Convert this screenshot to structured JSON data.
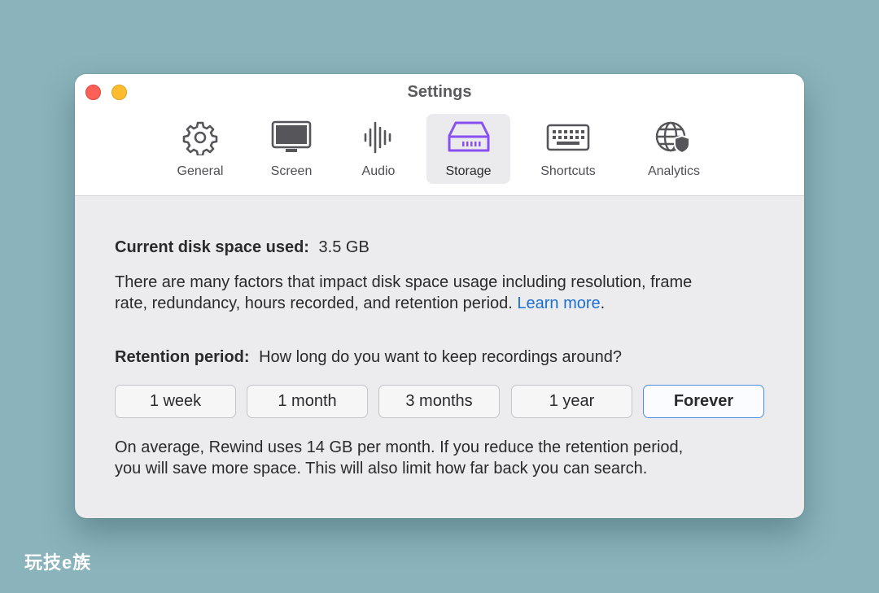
{
  "window": {
    "title": "Settings"
  },
  "tabs": [
    {
      "label": "General",
      "icon": "gear-icon"
    },
    {
      "label": "Screen",
      "icon": "monitor-icon"
    },
    {
      "label": "Audio",
      "icon": "audio-waveform-icon"
    },
    {
      "label": "Storage",
      "icon": "storage-drive-icon",
      "active": true
    },
    {
      "label": "Shortcuts",
      "icon": "keyboard-icon"
    },
    {
      "label": "Analytics",
      "icon": "globe-shield-icon"
    }
  ],
  "storage": {
    "disk_label": "Current disk space used:",
    "disk_value": "3.5 GB",
    "factors_line1": "There are many factors that impact disk space usage including resolution, frame",
    "factors_line2": "rate, redundancy, hours recorded, and retention period.",
    "learn_more": "Learn more",
    "period_end": ".",
    "retention_label": "Retention period:",
    "retention_question": "How long do you want to keep recordings around?",
    "options": [
      "1 week",
      "1 month",
      "3 months",
      "1 year",
      "Forever"
    ],
    "selected_option": "Forever",
    "avg_line1": "On average, Rewind uses 14 GB per month. If you reduce the retention period,",
    "avg_line2": "you will save more space. This will also limit how far back you can search."
  },
  "colors": {
    "accent": "#8a4ff0",
    "link": "#1a6fd6",
    "selection_border": "#4a8ee6"
  },
  "watermark": "玩技e族"
}
